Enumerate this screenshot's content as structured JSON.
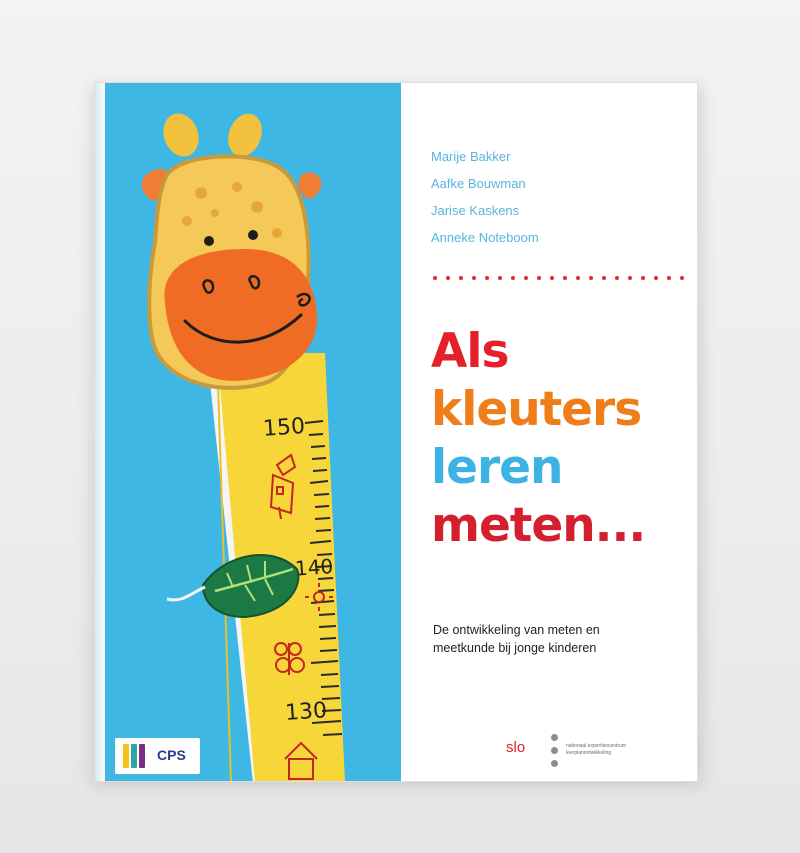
{
  "book": {
    "authors": [
      "Marije Bakker",
      "Aafke Bouwman",
      "Jarise Kaskens",
      "Anneke Noteboom"
    ],
    "title_lines": [
      "Als",
      "kleuters",
      "leren",
      "meten..."
    ],
    "subtitle_lines": [
      "De ontwikkeling van meten en",
      "meetkunde bij jonge kinderen"
    ],
    "measure_marks": [
      "150",
      "140",
      "130"
    ],
    "publisher_cps": "CPS",
    "publisher_slo": "slo",
    "slo_tagline": [
      "nationaal expertisecentrum",
      "leerplanontwikkeling"
    ]
  },
  "colors": {
    "cover_blue": "#3fb7e5",
    "title_red": "#e4202b",
    "title_orange": "#ef7d1a",
    "title_blue": "#3db2e4",
    "title_dark_red": "#d31f2e",
    "giraffe_yellow": "#f7d63a",
    "giraffe_orange": "#f06b24",
    "leaf_green": "#1b7a43"
  },
  "icons": {
    "cps_logo": "cps-logo-icon",
    "slo_logo": "slo-dots-icon",
    "giraffe_art": "giraffe-illustration-icon",
    "leaf": "leaf-icon"
  }
}
